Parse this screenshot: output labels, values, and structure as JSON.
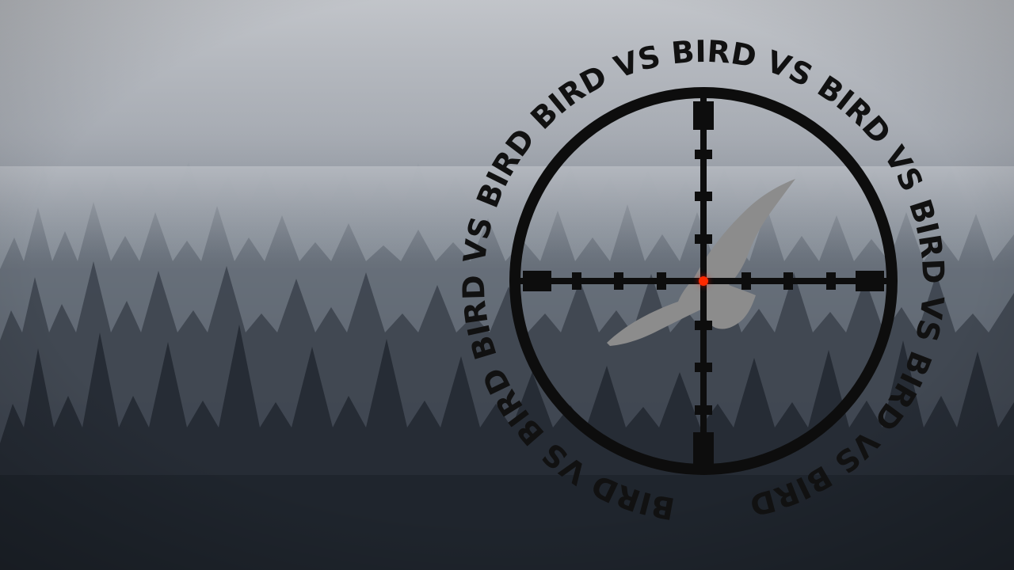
{
  "title_ring": {
    "text": "BIRD VS BIRD  BIRD VS BIRD  BIRD VS BIRD  VS BIRD VS BIRD  VS BIRD VS BIRD",
    "color": "#111111"
  },
  "scope": {
    "reticle_color": "#0d0d0d",
    "target_dot_color": "#ff2a00",
    "bird_silhouette_color": "#8c8c8c",
    "icon": "crosshair-icon"
  },
  "background": {
    "sky_color": "#b9bcc1",
    "forest_color": "#2f3640",
    "description_icon": "misty-forest-background"
  }
}
